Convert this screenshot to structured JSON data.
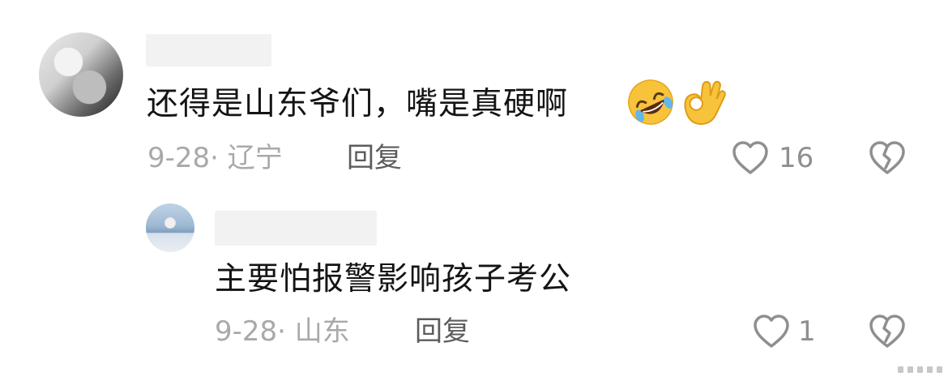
{
  "comments": [
    {
      "text": "还得是山东爷们，嘴是真硬啊",
      "emojis": [
        "rolling-on-floor-laughing-icon",
        "ok-hand-icon"
      ],
      "date_location": "9-28· 辽宁",
      "reply_label": "回复",
      "likes": "16"
    },
    {
      "text": "主要怕报警影响孩子考公",
      "date_location": "9-28· 山东",
      "reply_label": "回复",
      "likes": "1"
    }
  ],
  "colors": {
    "text": "#141414",
    "meta": "#a9a9a9",
    "reply": "#5c5c5c",
    "icon": "#8f8f8f",
    "emoji_yellow": "#f7c33b"
  }
}
